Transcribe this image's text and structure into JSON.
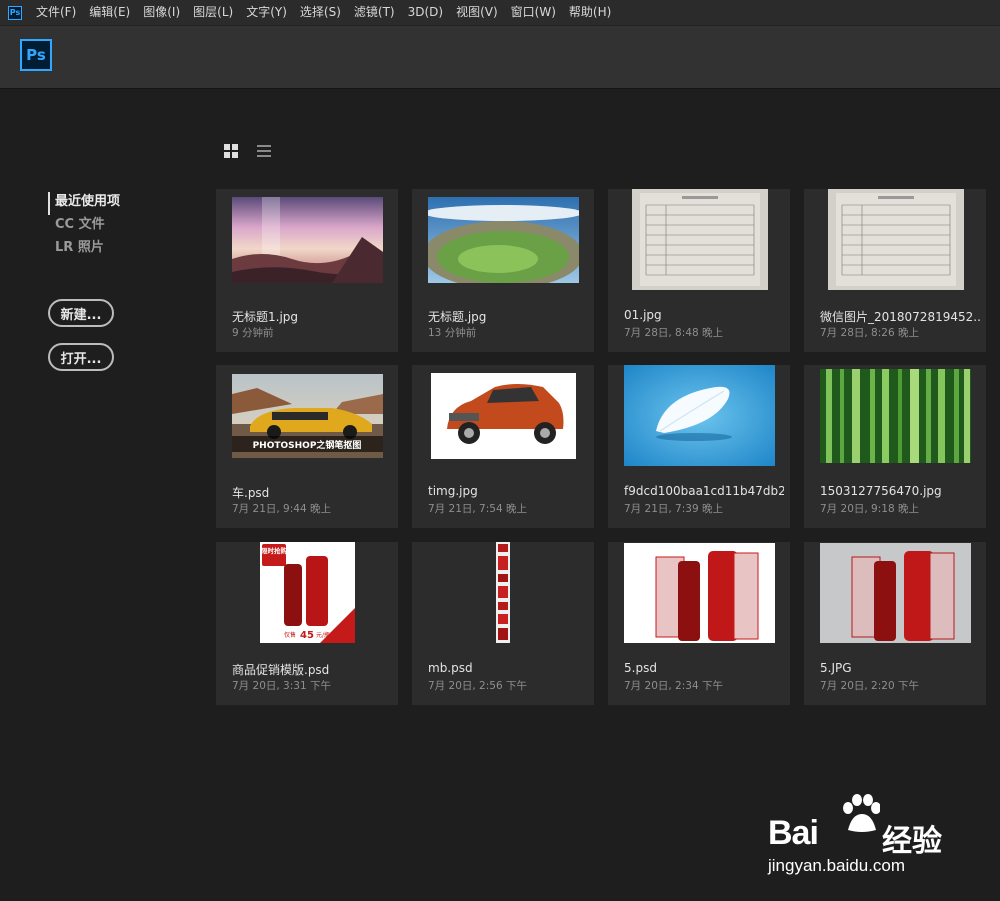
{
  "menubar": {
    "app_icon_text": "Ps",
    "items": [
      "文件(F)",
      "编辑(E)",
      "图像(I)",
      "图层(L)",
      "文字(Y)",
      "选择(S)",
      "滤镜(T)",
      "3D(D)",
      "视图(V)",
      "窗口(W)",
      "帮助(H)"
    ]
  },
  "header": {
    "logo_text": "Ps"
  },
  "sidebar": {
    "nav": [
      "最近使用项",
      "CC 文件",
      "LR 照片"
    ],
    "new_button": "新建...",
    "open_button": "打开..."
  },
  "recent_files": [
    {
      "name": "无标题1.jpg",
      "time": "9 分钟前",
      "thumb": "sunset-landscape"
    },
    {
      "name": "无标题.jpg",
      "time": "13 分钟前",
      "thumb": "crater-landscape"
    },
    {
      "name": "01.jpg",
      "time": "7月 28日, 8:48 晚上",
      "thumb": "document-form"
    },
    {
      "name": "微信图片_2018072819452...",
      "time": "7月 28日, 8:26 晚上",
      "thumb": "document-form"
    },
    {
      "name": "车.psd",
      "time": "7月 21日, 9:44 晚上",
      "thumb": "yellow-car",
      "thumb_text": "PHOTOSHOP之钢笔抠图"
    },
    {
      "name": "timg.jpg",
      "time": "7月 21日, 7:54 晚上",
      "thumb": "orange-suv"
    },
    {
      "name": "f9dcd100baa1cd11b47db23...",
      "time": "7月 21日, 7:39 晚上",
      "thumb": "feather"
    },
    {
      "name": "1503127756470.jpg",
      "time": "7月 20日, 9:18 晚上",
      "thumb": "bamboo"
    },
    {
      "name": "商品促销模版.psd",
      "time": "7月 20日, 3:31 下午",
      "thumb": "promo-poster",
      "thumb_text": [
        "限时抢购",
        "仅售",
        "45",
        "元/瓶"
      ]
    },
    {
      "name": "mb.psd",
      "time": "7月 20日, 2:56 下午",
      "thumb": "narrow-banner"
    },
    {
      "name": "5.psd",
      "time": "7月 20日, 2:34 下午",
      "thumb": "red-bottles"
    },
    {
      "name": "5.JPG",
      "time": "7月 20日, 2:20 下午",
      "thumb": "red-bottles-gray"
    }
  ],
  "watermark": {
    "brand": "Bai",
    "brand2": "经验",
    "url": "jingyan.baidu.com"
  },
  "colors": {
    "background": "#1e1e1e",
    "card": "#2c2c2c",
    "ps_blue": "#31a8ff",
    "ps_dark": "#001d34"
  }
}
